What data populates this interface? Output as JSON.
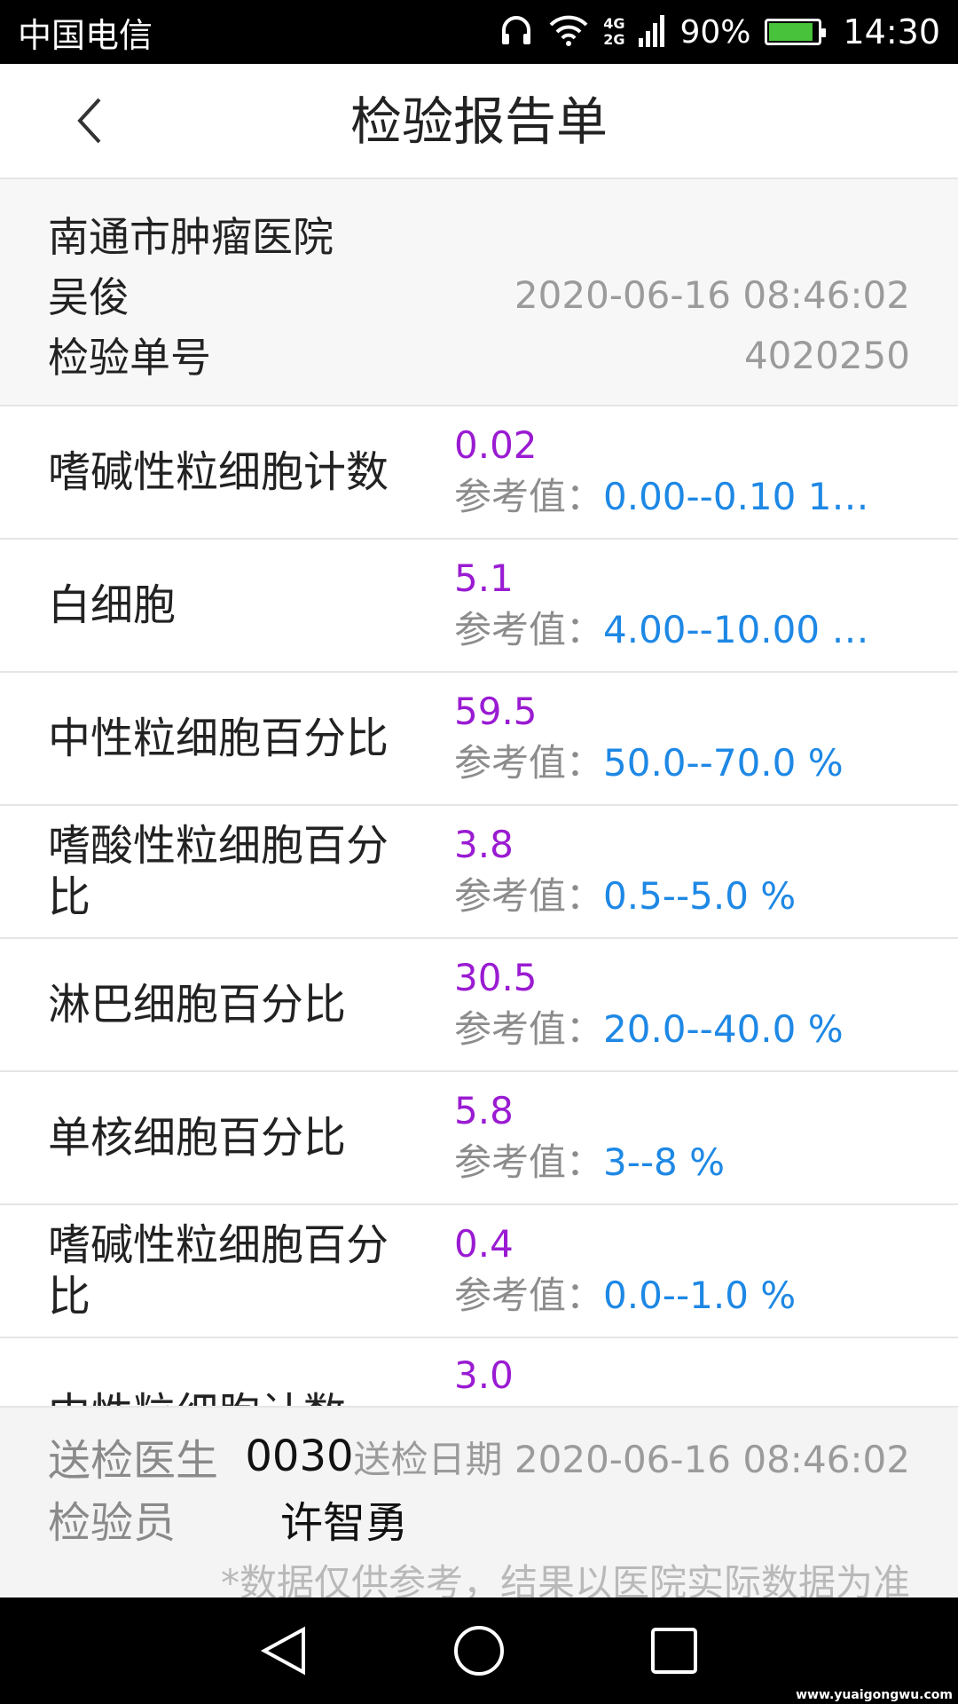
{
  "status_bar": {
    "carrier": "中国电信",
    "network_top": "4G",
    "network_bottom": "2G",
    "battery_percent": "90%",
    "battery_level": 0.9,
    "time": "14:30",
    "icons": [
      "headphones-icon",
      "wifi-icon",
      "signal-icon",
      "battery-icon"
    ]
  },
  "nav": {
    "title": "检验报告单",
    "back_icon": "chevron-left-icon"
  },
  "patient": {
    "hospital": "南通市肿瘤医院",
    "name": "吴俊",
    "datetime": "2020-06-16 08:46:02",
    "report_no_label": "检验单号",
    "report_no": "4020250"
  },
  "results": {
    "ref_label": "参考值：",
    "items": [
      {
        "name": "嗜碱性粒细胞计数",
        "value": "0.02",
        "ref": "0.00--0.10 10..."
      },
      {
        "name": "白细胞",
        "value": "5.1",
        "ref": "4.00--10.00 1..."
      },
      {
        "name": "中性粒细胞百分比",
        "value": "59.5",
        "ref": "50.0--70.0 %"
      },
      {
        "name": "嗜酸性粒细胞百分比",
        "value": "3.8",
        "ref": "0.5--5.0 %"
      },
      {
        "name": "淋巴细胞百分比",
        "value": "30.5",
        "ref": "20.0--40.0 %"
      },
      {
        "name": "单核细胞百分比",
        "value": "5.8",
        "ref": "3--8 %"
      },
      {
        "name": "嗜碱性粒细胞百分比",
        "value": "0.4",
        "ref": "0.0--1.0 %"
      },
      {
        "name": "中性粒细胞计数",
        "value": "3.0",
        "ref": ""
      }
    ]
  },
  "footer": {
    "doctor_label": "送检医生",
    "doctor": "0030",
    "date_label": "送检日期",
    "date": "2020-06-16 08:46:02",
    "inspector_label": "检验员",
    "inspector": "许智勇",
    "disclaimer": "*数据仅供参考，结果以医院实际数据为准"
  },
  "system_nav": {
    "back": "triangle-back-icon",
    "home": "circle-home-icon",
    "recents": "square-recents-icon"
  },
  "watermark": "www.yuaigongwu.com"
}
